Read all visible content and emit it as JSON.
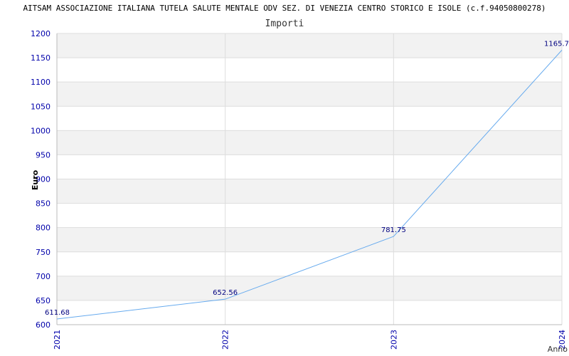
{
  "chart_data": {
    "type": "line",
    "title": "AITSAM ASSOCIAZIONE ITALIANA TUTELA SALUTE MENTALE ODV SEZ. DI VENEZIA CENTRO STORICO E ISOLE (c.f.94050800278)",
    "subtitle": "Importi",
    "xlabel": "Anno",
    "ylabel": "Euro",
    "categories": [
      "2021",
      "2022",
      "2023",
      "2024"
    ],
    "values": [
      611.68,
      652.56,
      781.75,
      1165.7
    ],
    "value_labels": [
      "611.68",
      "652.56",
      "781.75",
      "1165.7"
    ],
    "ylim": [
      600,
      1200
    ],
    "yticks": [
      600,
      650,
      700,
      750,
      800,
      850,
      900,
      950,
      1000,
      1050,
      1100,
      1150,
      1200
    ],
    "grid": true,
    "colors": {
      "line": "#66aaee",
      "band": "#f2f2f2",
      "tick_text": "#0000aa",
      "data_label": "#000080"
    }
  }
}
